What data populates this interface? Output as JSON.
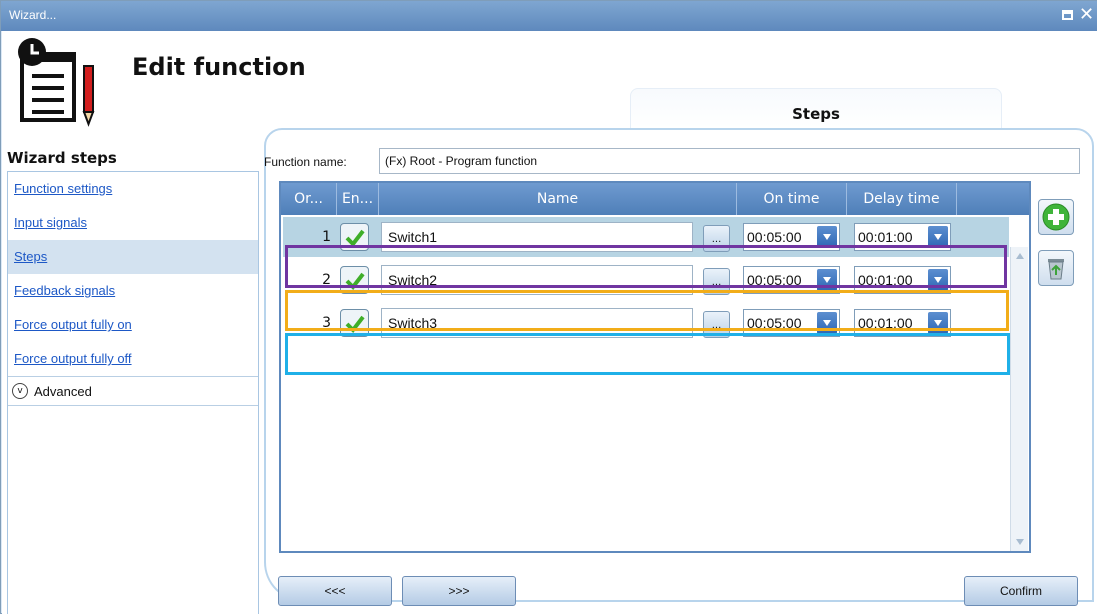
{
  "window": {
    "title": "Wizard..."
  },
  "header": {
    "title": "Edit function",
    "tab_label": "Steps"
  },
  "sidebar": {
    "heading": "Wizard steps",
    "items": [
      {
        "label": "Function settings",
        "active": false
      },
      {
        "label": "Input signals",
        "active": false
      },
      {
        "label": "Steps",
        "active": true
      },
      {
        "label": "Feedback signals",
        "active": false
      },
      {
        "label": "Force output fully on",
        "active": false
      },
      {
        "label": "Force output fully off",
        "active": false
      }
    ],
    "advanced_label": "Advanced"
  },
  "form": {
    "function_name_label": "Function name:",
    "function_name_value": "(Fx) Root - Program function"
  },
  "table": {
    "columns": [
      "Or...",
      "En...",
      "Name",
      "On time",
      "Delay time"
    ],
    "rows": [
      {
        "order": "1",
        "enabled": true,
        "name": "Switch1",
        "dots": "...",
        "on_time": "00:05:00",
        "delay_time": "00:01:00"
      },
      {
        "order": "2",
        "enabled": true,
        "name": "Switch2",
        "dots": "...",
        "on_time": "00:05:00",
        "delay_time": "00:01:00"
      },
      {
        "order": "3",
        "enabled": true,
        "name": "Switch3",
        "dots": "...",
        "on_time": "00:05:00",
        "delay_time": "00:01:00"
      }
    ],
    "highlight_colors": [
      "#7035a1",
      "#f2ad19",
      "#1fb0e8"
    ]
  },
  "actions": {
    "add_icon": "add-icon",
    "delete_icon": "recycle-bin-icon"
  },
  "footer": {
    "prev_label": "<<<",
    "next_label": ">>>",
    "confirm_label": "Confirm"
  }
}
